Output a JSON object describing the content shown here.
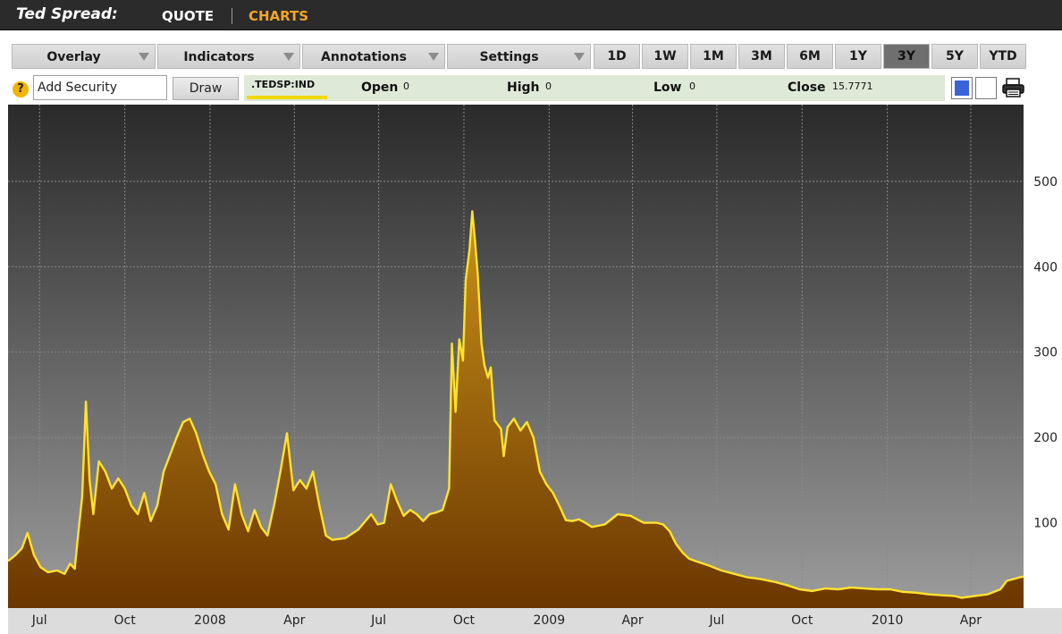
{
  "header": {
    "title": "Ted Spread:",
    "tabs": [
      {
        "label": "QUOTE",
        "active": false
      },
      {
        "label": "CHARTS",
        "active": true
      }
    ]
  },
  "toolbar": {
    "dropdowns": [
      "Overlay",
      "Indicators",
      "Annotations",
      "Settings"
    ],
    "ranges": [
      "1D",
      "1W",
      "1M",
      "3M",
      "6M",
      "1Y",
      "3Y",
      "5Y",
      "YTD"
    ],
    "active_range": "3Y"
  },
  "security_row": {
    "help_icon": "?",
    "add_security_value": "Add Security",
    "draw_label": "Draw",
    "ticker": ".TEDSP:IND",
    "open_label": "Open",
    "open_value": "0",
    "high_label": "High",
    "high_value": "0",
    "low_label": "Low",
    "low_value": "0",
    "close_label": "Close",
    "close_value": "15.7771"
  },
  "colors": {
    "line": "#ffe230",
    "fill_top": "#c9921a",
    "fill_bottom": "#6b3600",
    "bg_top": "#2a2a2a",
    "bg_bottom": "#9c9c9c",
    "active_tab": "#f5a623"
  },
  "icons": [
    "help-icon",
    "dropdown-arrow-icon",
    "color-swatch-icon",
    "printer-icon"
  ],
  "chart_data": {
    "type": "area",
    "title": "",
    "xlabel": "",
    "ylabel": "",
    "ylim": [
      0,
      590
    ],
    "xlim": [
      "2007-05-28",
      "2010-05-28"
    ],
    "y_ticks": [
      100,
      200,
      300,
      400,
      500
    ],
    "x_ticks": [
      {
        "label": "Jul",
        "date": "2007-07-01"
      },
      {
        "label": "Oct",
        "date": "2007-10-01"
      },
      {
        "label": "2008",
        "date": "2008-01-01"
      },
      {
        "label": "Apr",
        "date": "2008-04-01"
      },
      {
        "label": "Jul",
        "date": "2008-07-01"
      },
      {
        "label": "Oct",
        "date": "2008-10-01"
      },
      {
        "label": "2009",
        "date": "2009-01-01"
      },
      {
        "label": "Apr",
        "date": "2009-04-01"
      },
      {
        "label": "Jul",
        "date": "2009-07-01"
      },
      {
        "label": "Oct",
        "date": "2009-10-01"
      },
      {
        "label": "2010",
        "date": "2010-01-01"
      },
      {
        "label": "Apr",
        "date": "2010-04-01"
      }
    ],
    "grid": true,
    "legend": "none",
    "series": [
      {
        "name": ".TEDSP:IND",
        "points": [
          [
            "2007-05-28",
            55
          ],
          [
            "2007-06-05",
            62
          ],
          [
            "2007-06-12",
            70
          ],
          [
            "2007-06-18",
            88
          ],
          [
            "2007-06-25",
            62
          ],
          [
            "2007-07-02",
            48
          ],
          [
            "2007-07-10",
            42
          ],
          [
            "2007-07-20",
            44
          ],
          [
            "2007-07-28",
            40
          ],
          [
            "2007-08-03",
            52
          ],
          [
            "2007-08-08",
            46
          ],
          [
            "2007-08-12",
            90
          ],
          [
            "2007-08-16",
            130
          ],
          [
            "2007-08-20",
            242
          ],
          [
            "2007-08-24",
            150
          ],
          [
            "2007-08-28",
            110
          ],
          [
            "2007-09-03",
            172
          ],
          [
            "2007-09-10",
            160
          ],
          [
            "2007-09-17",
            140
          ],
          [
            "2007-09-24",
            152
          ],
          [
            "2007-10-01",
            140
          ],
          [
            "2007-10-08",
            120
          ],
          [
            "2007-10-15",
            110
          ],
          [
            "2007-10-22",
            135
          ],
          [
            "2007-10-29",
            102
          ],
          [
            "2007-11-05",
            120
          ],
          [
            "2007-11-12",
            160
          ],
          [
            "2007-11-19",
            180
          ],
          [
            "2007-11-26",
            200
          ],
          [
            "2007-12-03",
            218
          ],
          [
            "2007-12-10",
            222
          ],
          [
            "2007-12-17",
            205
          ],
          [
            "2007-12-24",
            180
          ],
          [
            "2007-12-31",
            160
          ],
          [
            "2008-01-07",
            145
          ],
          [
            "2008-01-14",
            110
          ],
          [
            "2008-01-21",
            92
          ],
          [
            "2008-01-28",
            145
          ],
          [
            "2008-02-04",
            110
          ],
          [
            "2008-02-11",
            90
          ],
          [
            "2008-02-18",
            115
          ],
          [
            "2008-02-25",
            95
          ],
          [
            "2008-03-03",
            85
          ],
          [
            "2008-03-10",
            120
          ],
          [
            "2008-03-17",
            160
          ],
          [
            "2008-03-24",
            205
          ],
          [
            "2008-03-31",
            138
          ],
          [
            "2008-04-07",
            150
          ],
          [
            "2008-04-14",
            140
          ],
          [
            "2008-04-21",
            160
          ],
          [
            "2008-04-28",
            120
          ],
          [
            "2008-05-05",
            85
          ],
          [
            "2008-05-12",
            80
          ],
          [
            "2008-05-26",
            82
          ],
          [
            "2008-06-09",
            92
          ],
          [
            "2008-06-23",
            110
          ],
          [
            "2008-06-30",
            98
          ],
          [
            "2008-07-07",
            100
          ],
          [
            "2008-07-14",
            145
          ],
          [
            "2008-07-21",
            125
          ],
          [
            "2008-07-28",
            108
          ],
          [
            "2008-08-04",
            115
          ],
          [
            "2008-08-11",
            110
          ],
          [
            "2008-08-18",
            102
          ],
          [
            "2008-08-25",
            110
          ],
          [
            "2008-09-01",
            112
          ],
          [
            "2008-09-08",
            115
          ],
          [
            "2008-09-15",
            140
          ],
          [
            "2008-09-18",
            310
          ],
          [
            "2008-09-22",
            230
          ],
          [
            "2008-09-26",
            315
          ],
          [
            "2008-09-30",
            290
          ],
          [
            "2008-10-03",
            385
          ],
          [
            "2008-10-07",
            420
          ],
          [
            "2008-10-10",
            465
          ],
          [
            "2008-10-13",
            430
          ],
          [
            "2008-10-16",
            390
          ],
          [
            "2008-10-20",
            310
          ],
          [
            "2008-10-23",
            285
          ],
          [
            "2008-10-27",
            270
          ],
          [
            "2008-10-30",
            282
          ],
          [
            "2008-11-03",
            220
          ],
          [
            "2008-11-10",
            210
          ],
          [
            "2008-11-13",
            178
          ],
          [
            "2008-11-17",
            212
          ],
          [
            "2008-11-24",
            222
          ],
          [
            "2008-12-01",
            208
          ],
          [
            "2008-12-08",
            218
          ],
          [
            "2008-12-15",
            200
          ],
          [
            "2008-12-22",
            160
          ],
          [
            "2008-12-29",
            145
          ],
          [
            "2009-01-05",
            135
          ],
          [
            "2009-01-12",
            120
          ],
          [
            "2009-01-19",
            103
          ],
          [
            "2009-01-26",
            102
          ],
          [
            "2009-02-02",
            104
          ],
          [
            "2009-02-09",
            100
          ],
          [
            "2009-02-16",
            95
          ],
          [
            "2009-03-02",
            98
          ],
          [
            "2009-03-16",
            110
          ],
          [
            "2009-03-30",
            108
          ],
          [
            "2009-04-13",
            100
          ],
          [
            "2009-04-27",
            100
          ],
          [
            "2009-05-04",
            98
          ],
          [
            "2009-05-11",
            90
          ],
          [
            "2009-05-18",
            75
          ],
          [
            "2009-05-25",
            65
          ],
          [
            "2009-06-01",
            58
          ],
          [
            "2009-06-08",
            55
          ],
          [
            "2009-06-22",
            50
          ],
          [
            "2009-07-06",
            44
          ],
          [
            "2009-07-20",
            40
          ],
          [
            "2009-08-03",
            36
          ],
          [
            "2009-08-17",
            34
          ],
          [
            "2009-08-31",
            31
          ],
          [
            "2009-09-14",
            27
          ],
          [
            "2009-09-28",
            22
          ],
          [
            "2009-10-12",
            20
          ],
          [
            "2009-10-26",
            23
          ],
          [
            "2009-11-09",
            22
          ],
          [
            "2009-11-23",
            24
          ],
          [
            "2009-12-07",
            23
          ],
          [
            "2009-12-21",
            22
          ],
          [
            "2010-01-04",
            22
          ],
          [
            "2010-01-18",
            19
          ],
          [
            "2010-02-01",
            18
          ],
          [
            "2010-02-15",
            16
          ],
          [
            "2010-03-01",
            15
          ],
          [
            "2010-03-15",
            14
          ],
          [
            "2010-03-22",
            12
          ],
          [
            "2010-04-05",
            14
          ],
          [
            "2010-04-19",
            16
          ],
          [
            "2010-05-03",
            22
          ],
          [
            "2010-05-10",
            32
          ],
          [
            "2010-05-17",
            34
          ],
          [
            "2010-05-24",
            36
          ],
          [
            "2010-05-28",
            37
          ]
        ]
      }
    ]
  }
}
